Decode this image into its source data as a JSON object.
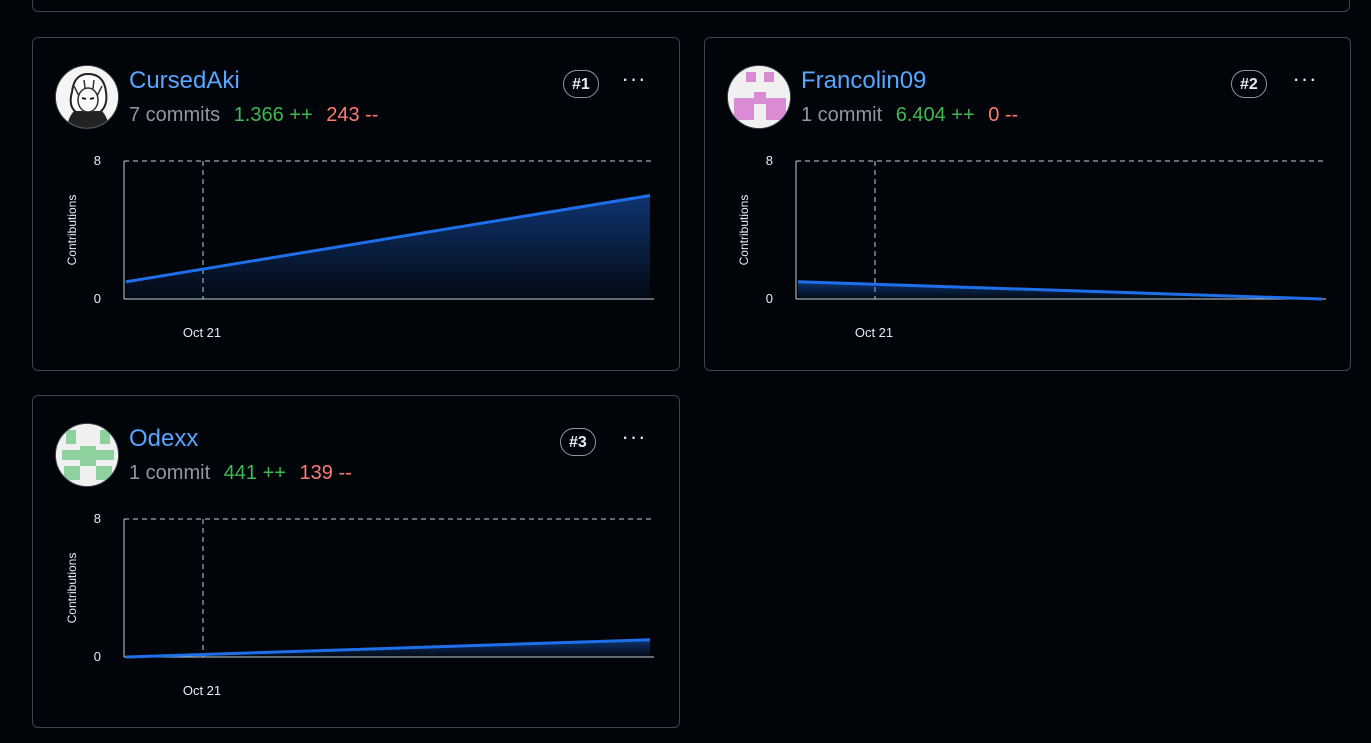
{
  "contributors": [
    {
      "username": "CursedAki",
      "commits": "7 commits",
      "additions": "1.366 ++",
      "deletions": "243 --",
      "rank": "#1",
      "avatar": "anime-portrait-avatar"
    },
    {
      "username": "Francolin09",
      "commits": "1 commit",
      "additions": "6.404 ++",
      "deletions": "0 --",
      "rank": "#2",
      "avatar": "identicon-pink"
    },
    {
      "username": "Odexx",
      "commits": "1 commit",
      "additions": "441 ++",
      "deletions": "139 --",
      "rank": "#3",
      "avatar": "identicon-green"
    }
  ],
  "chart_data": [
    {
      "type": "area",
      "ylabel": "Contributions",
      "ylim": [
        0,
        8
      ],
      "y_ticks": [
        "0",
        "8"
      ],
      "x_ticks": [
        "Oct 21"
      ],
      "series": [
        {
          "values": [
            1,
            6
          ]
        }
      ],
      "grid": true
    },
    {
      "type": "area",
      "ylabel": "Contributions",
      "ylim": [
        0,
        8
      ],
      "y_ticks": [
        "0",
        "8"
      ],
      "x_ticks": [
        "Oct 21"
      ],
      "series": [
        {
          "values": [
            1,
            0
          ]
        }
      ],
      "grid": true
    },
    {
      "type": "area",
      "ylabel": "Contributions",
      "ylim": [
        0,
        8
      ],
      "y_ticks": [
        "0",
        "8"
      ],
      "x_ticks": [
        "Oct 21"
      ],
      "series": [
        {
          "values": [
            0,
            1
          ]
        }
      ],
      "grid": true
    }
  ],
  "colors": {
    "line": "#1f6feb",
    "username": "#58a6ff",
    "additions": "#3fb950",
    "deletions": "#ff7b72"
  }
}
